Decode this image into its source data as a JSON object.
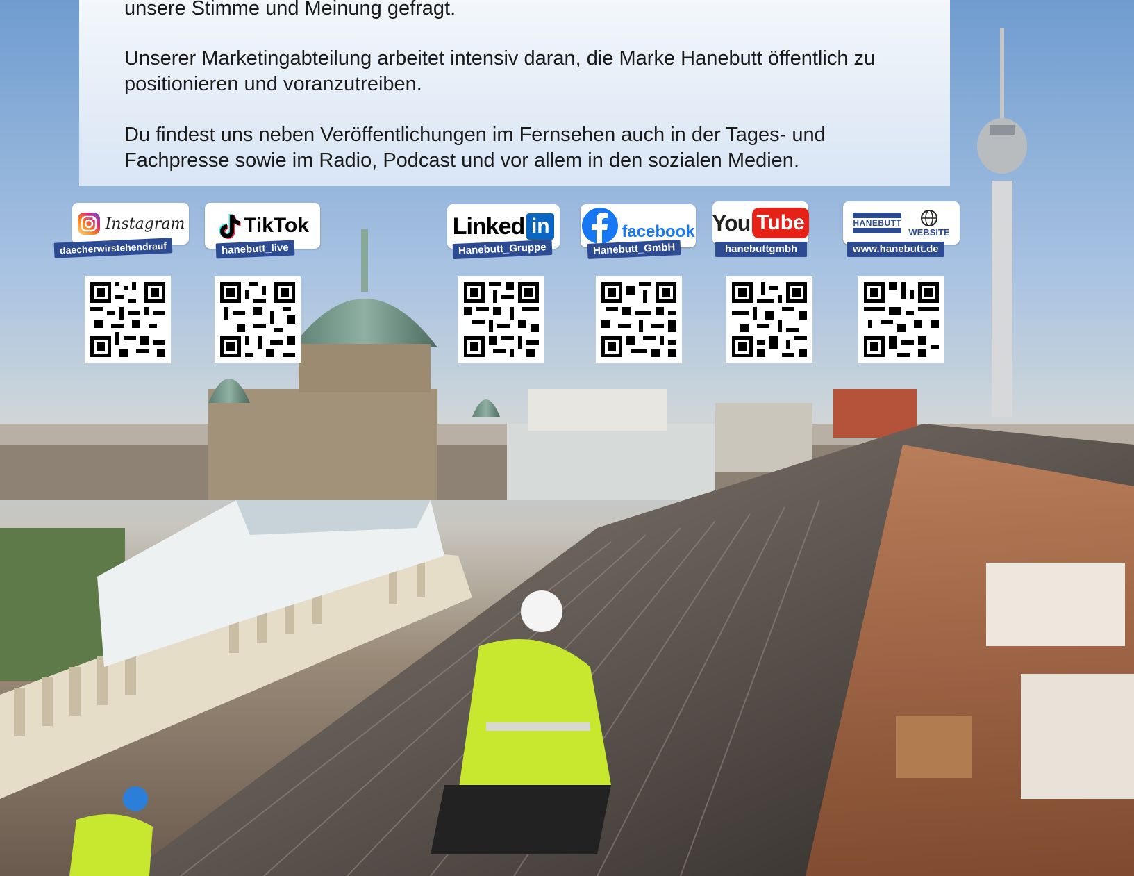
{
  "text": {
    "paragraph1": "unsere Stimme und Meinung gefragt.",
    "paragraph2": "Unserer Marketingabteilung arbeitet intensiv daran, die Marke Hanebutt öffentlich zu positionieren und voranzutreiben.",
    "paragraph3": "Du findest uns neben Veröffentlichungen im Fernsehen auch in der Tages- und Fachpresse sowie im Radio, Podcast und vor allem in den sozialen Medien."
  },
  "social": [
    {
      "network": "Instagram",
      "logo_text": "Instagram",
      "handle": "daecherwirstehendrauf",
      "icon": "instagram-icon",
      "color": "#d6249f"
    },
    {
      "network": "TikTok",
      "logo_text": "TikTok",
      "handle": "hanebutt_live",
      "icon": "tiktok-icon",
      "color": "#000000"
    },
    {
      "network": "LinkedIn",
      "logo_text": "Linked",
      "logo_suffix": "in",
      "handle": "Hanebutt_Gruppe",
      "icon": "linkedin-icon",
      "color": "#0a66c2"
    },
    {
      "network": "Facebook",
      "logo_text": "facebook",
      "handle": "Hanebutt_GmbH",
      "icon": "facebook-icon",
      "color": "#1877f2"
    },
    {
      "network": "YouTube",
      "logo_text": "You",
      "logo_suffix": "Tube",
      "handle": "hanebuttgmbh",
      "icon": "youtube-icon",
      "color": "#e62117"
    },
    {
      "network": "Website",
      "logo_text": "HANEBUTT",
      "logo_suffix": "WEBSITE",
      "handle": "www.hanebutt.de",
      "icon": "globe-icon",
      "color": "#2c4b93"
    }
  ],
  "colors": {
    "handle_bg": "#2c4b93",
    "text": "#1a1a1a"
  }
}
